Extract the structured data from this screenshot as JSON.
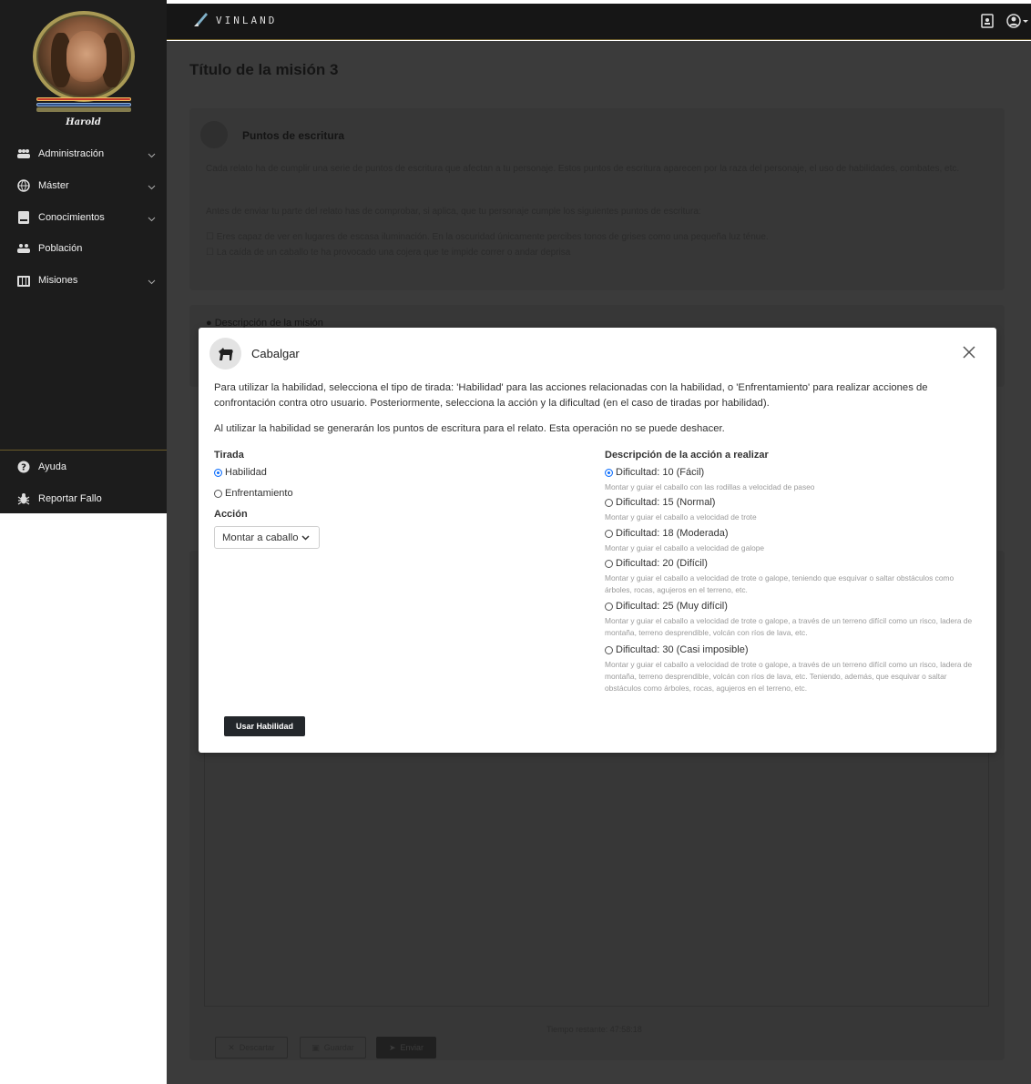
{
  "user": {
    "name": "Harold"
  },
  "sidebar": {
    "items": [
      {
        "label": "Administración",
        "icon": "users-cog-icon",
        "has_chevron": true
      },
      {
        "label": "Máster",
        "icon": "globe-icon",
        "has_chevron": true
      },
      {
        "label": "Conocimientos",
        "icon": "book-icon",
        "has_chevron": true
      },
      {
        "label": "Población",
        "icon": "people-icon",
        "has_chevron": false
      },
      {
        "label": "Misiones",
        "icon": "mission-board-icon",
        "has_chevron": true
      }
    ],
    "bottom_items": [
      {
        "label": "Ayuda",
        "icon": "help-circle-icon"
      },
      {
        "label": "Reportar Fallo",
        "icon": "bug-icon"
      }
    ]
  },
  "topbar": {
    "brand": "VINLAND"
  },
  "page": {
    "title": "Título de la misión 3",
    "writing_points": {
      "title": "Puntos de escritura",
      "intro": "Cada relato ha de cumplir una serie de puntos de escritura que afectan a tu personaje. Estos puntos de escritura aparecen por la raza del personaje, el uso de habilidades, combates, etc.",
      "check_note": "Antes de enviar tu parte del relato has de comprobar, si aplica, que tu personaje cumple los siguientes puntos de escritura:",
      "checks": [
        "Eres capaz de ver en lugares de escasa iluminación. En la oscuridad únicamente percibes tonos de grises como una pequeña luz ténue.",
        "La caída de un caballo te ha provocado una cojera que te impide correr o andar deprisa"
      ]
    },
    "mission_description_label": "Descripción de la misión",
    "time_remaining": "Tiempo restante: 47:58:18",
    "buttons": {
      "discard": "Descartar",
      "save": "Guardar",
      "send": "Enviar"
    }
  },
  "modal": {
    "title": "Cabalgar",
    "paragraph1": "Para utilizar la habilidad, selecciona el tipo de tirada: 'Habilidad' para las acciones relacionadas con la habilidad, o 'Enfrentamiento' para realizar acciones de confrontación contra otro usuario. Posteriormente, selecciona la acción y la dificultad (en el caso de tiradas por habilidad).",
    "paragraph2": "Al utilizar la habilidad se generarán los puntos de escritura para el relato. Esta operación no se puede deshacer.",
    "roll_type": {
      "heading": "Tirada",
      "options": [
        {
          "label": "Habilidad",
          "selected": true
        },
        {
          "label": "Enfrentamiento",
          "selected": false
        }
      ]
    },
    "action": {
      "heading": "Acción",
      "selected": "Montar a caballo"
    },
    "description": {
      "heading": "Descripción de la acción a realizar",
      "options": [
        {
          "label": "Dificultad: 10 (Fácil)",
          "selected": true,
          "desc": "Montar y guiar el caballo con las rodillas a velocidad de paseo"
        },
        {
          "label": "Dificultad: 15 (Normal)",
          "selected": false,
          "desc": "Montar y guiar el caballo a velocidad de trote"
        },
        {
          "label": "Dificultad: 18 (Moderada)",
          "selected": false,
          "desc": "Montar y guiar el caballo a velocidad de galope"
        },
        {
          "label": "Dificultad: 20 (Difícil)",
          "selected": false,
          "desc": "Montar y guiar el caballo a velocidad de trote o galope, teniendo que esquivar o saltar obstáculos como árboles, rocas, agujeros en el terreno, etc."
        },
        {
          "label": "Dificultad: 25 (Muy difícil)",
          "selected": false,
          "desc": "Montar y guiar el caballo a velocidad de trote o galope, a través de un terreno difícil como un risco, ladera de montaña, terreno desprendible, volcán con ríos de lava, etc."
        },
        {
          "label": "Dificultad: 30 (Casi imposible)",
          "selected": false,
          "desc": "Montar y guiar el caballo a velocidad de trote o galope, a través de un terreno difícil como un risco, ladera de montaña, terreno desprendible, volcán con ríos de lava, etc. Teniendo, además, que esquivar o saltar obstáculos como árboles, rocas, agujeros en el terreno, etc."
        }
      ]
    },
    "submit": "Usar Habilidad"
  },
  "colors": {
    "sidebar_bg": "#1c1c1c",
    "accent_gold": "#6b5b2a",
    "overlay": "#3b3b3b",
    "radio_selected": "#0d6efd"
  }
}
